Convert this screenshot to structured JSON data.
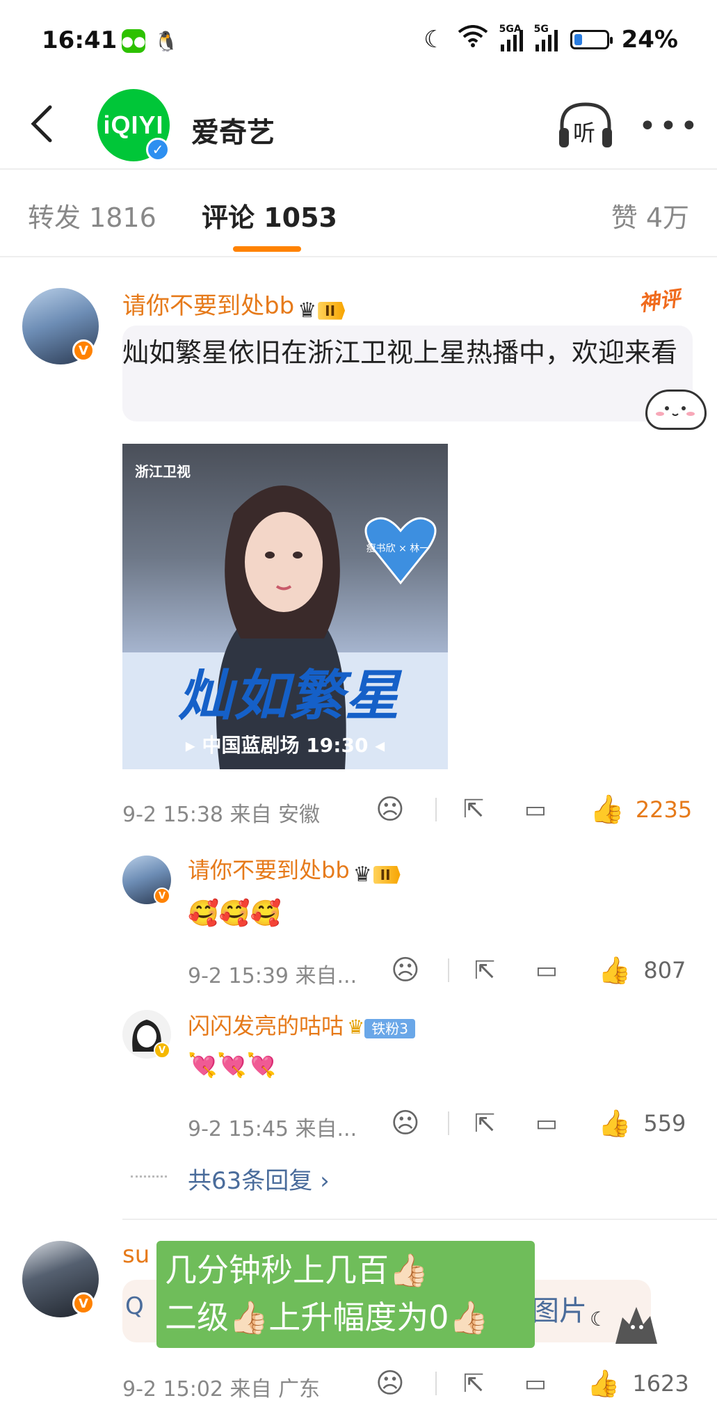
{
  "status_bar": {
    "time": "16:41",
    "battery": "24%",
    "signal1": "5GA",
    "signal2": "5G",
    "battery_level": 0.24
  },
  "header": {
    "account_name": "爱奇艺",
    "logo_text": "iQIYI",
    "listen_label": "听"
  },
  "tabs": {
    "repost": "转发 1816",
    "comments": "评论 1053",
    "likes": "赞 4万"
  },
  "comment1": {
    "user": "请你不要到处bb",
    "level": "II",
    "badge": "神评",
    "text": "灿如繁星依旧在浙江卫视上星热播中，欢迎来看",
    "time_location": "9-2 15:38  来自 安徽",
    "likes": "2235",
    "image": {
      "channel": "浙江卫视",
      "heart_text": "瘦书欣 × 林一",
      "title": "灿如繁星",
      "slot": "中国蓝剧场 19:30"
    }
  },
  "reply1": {
    "user": "请你不要到处bb",
    "level": "II",
    "emojis": "🥰🥰🥰",
    "time_location": "9-2 15:39  来自...",
    "likes": "807"
  },
  "reply2": {
    "user": "闪闪发亮的咕咕",
    "fan_badge": "铁粉3",
    "emojis": "💘💘💘",
    "time_location": "9-2 15:45  来自...",
    "likes": "559"
  },
  "more_replies": "共63条回复",
  "comment2": {
    "user_partial": "su",
    "search_text": "图片",
    "time_location": "9-2 15:02  来自 广东",
    "likes": "1623"
  },
  "overlay": {
    "line1": "几分钟秒上几百👍🏻",
    "line2": "二级👍🏻上升幅度为0👍🏻"
  }
}
